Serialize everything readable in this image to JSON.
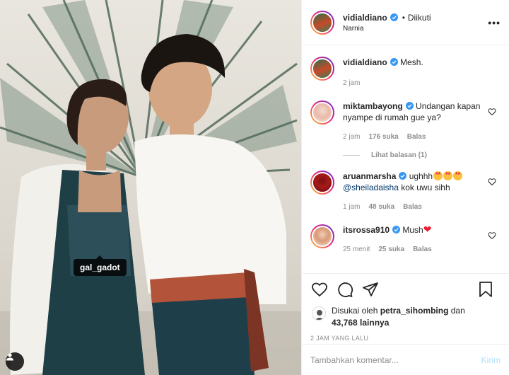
{
  "photo": {
    "tag_label": "gal_gadot"
  },
  "header": {
    "username": "vidialdiano",
    "dot": "•",
    "follow_status": "Diikuti",
    "location": "Narnia",
    "more_label": "•••"
  },
  "comments": [
    {
      "username": "vidialdiano",
      "text": "Mesh.",
      "time": "2 jam"
    },
    {
      "username": "miktambayong",
      "text": "Undangan kapan nyampe di rumah gue ya?",
      "time": "2 jam",
      "likes": "176 suka",
      "reply": "Balas"
    },
    {
      "username": "aruanmarsha",
      "text": "ughhh",
      "mention": "@sheiladaisha",
      "text2": "kok uwu sihh",
      "time": "1 jam",
      "likes": "48 suka",
      "reply": "Balas"
    },
    {
      "username": "itsrossa910",
      "text": "Mush",
      "time": "25 menit",
      "likes": "25 suka",
      "reply": "Balas"
    }
  ],
  "view_replies": "Lihat balasan (1)",
  "likes": {
    "prefix": "Disukai oleh",
    "user": "petra_sihombing",
    "suffix": "dan",
    "count": "43,768 lainnya"
  },
  "timestamp": "2 JAM YANG LALU",
  "add_comment": {
    "placeholder": "Tambahkan komentar...",
    "send_label": "Kirim"
  },
  "colors": {
    "accent_blue": "#0095f6",
    "verified_blue": "#3897f0",
    "send_disabled": "#b2dffc"
  }
}
